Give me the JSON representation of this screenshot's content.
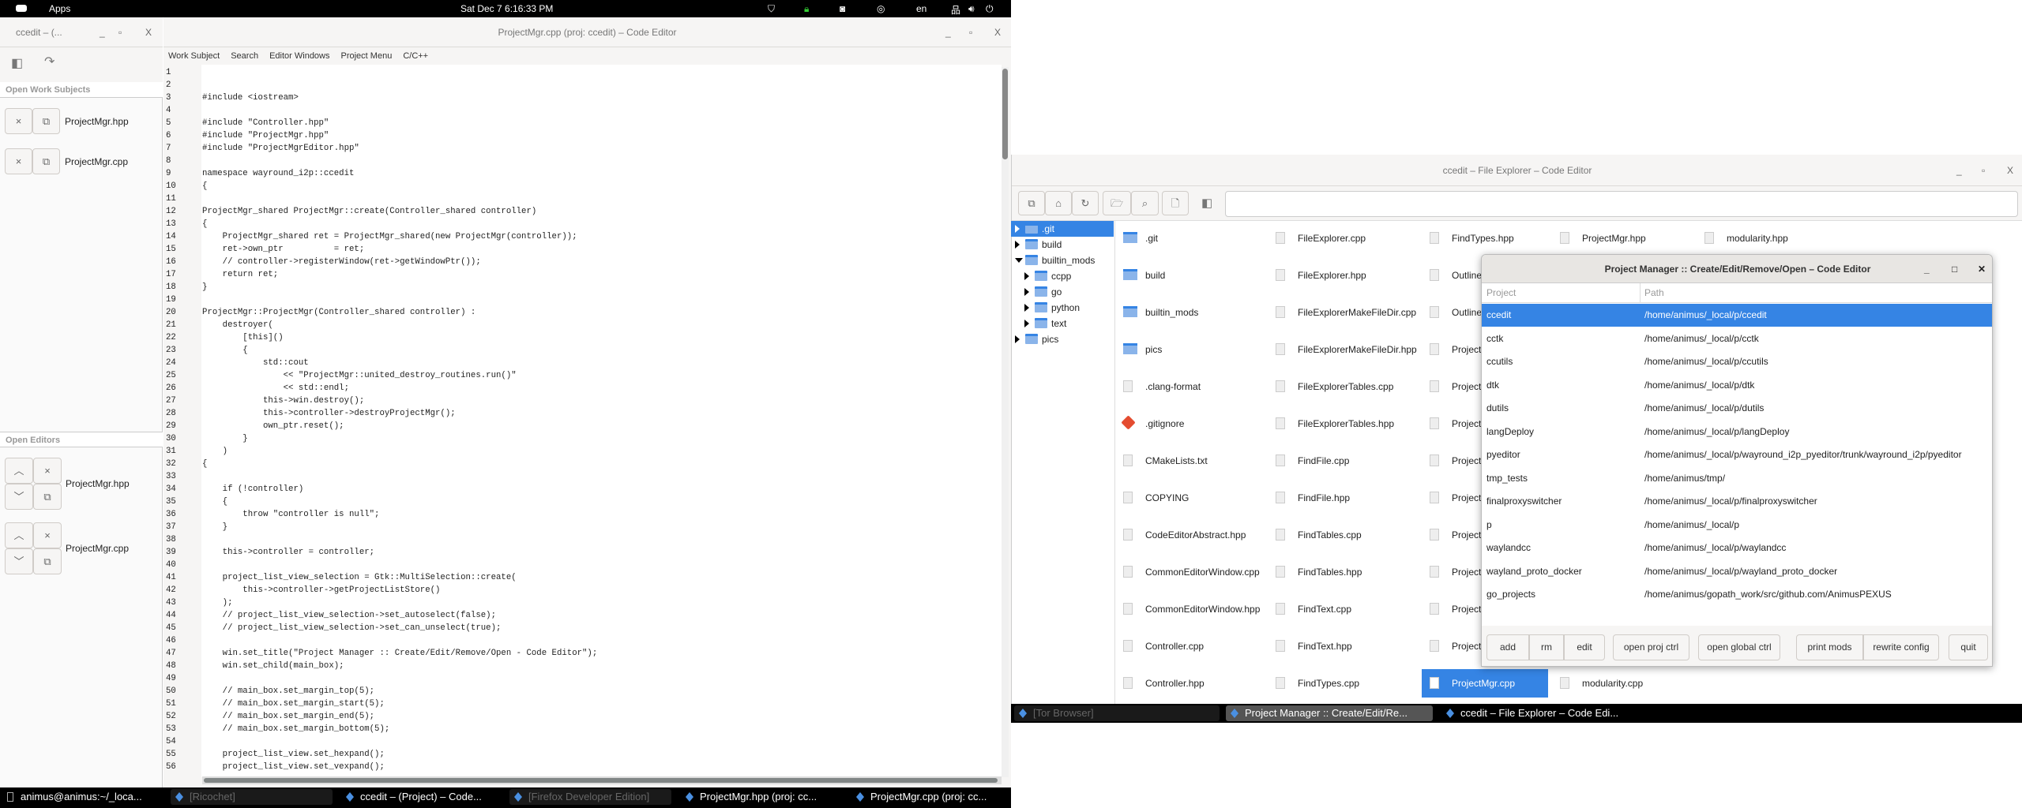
{
  "topbar": {
    "apps": "Apps",
    "datetime": "Sat Dec 7   6:16:33 PM",
    "lang": "en",
    "tray_icons": [
      "tor-icon",
      "lock-icon",
      "discord-icon",
      "steam-icon",
      "network-icon",
      "volume-icon",
      "power-icon"
    ]
  },
  "side_window": {
    "title": "ccedit – (...",
    "open_work_subjects": "Open Work Subjects",
    "work_subjects": [
      "ProjectMgr.hpp",
      "ProjectMgr.cpp"
    ],
    "open_editors": "Open Editors",
    "editors": [
      "ProjectMgr.hpp",
      "ProjectMgr.cpp"
    ]
  },
  "editor": {
    "title": "ProjectMgr.cpp (proj: ccedit) – Code Editor",
    "menu": [
      "Work Subject",
      "Search",
      "Editor Windows",
      "Project Menu",
      "C/C++"
    ],
    "lines": [
      "",
      "",
      "#include <iostream>",
      "",
      "#include \"Controller.hpp\"",
      "#include \"ProjectMgr.hpp\"",
      "#include \"ProjectMgrEditor.hpp\"",
      "",
      "namespace wayround_i2p::ccedit",
      "{",
      "",
      "ProjectMgr_shared ProjectMgr::create(Controller_shared controller)",
      "{",
      "    ProjectMgr_shared ret = ProjectMgr_shared(new ProjectMgr(controller));",
      "    ret->own_ptr          = ret;",
      "    // controller->registerWindow(ret->getWindowPtr());",
      "    return ret;",
      "}",
      "",
      "ProjectMgr::ProjectMgr(Controller_shared controller) :",
      "    destroyer(",
      "        [this]()",
      "        {",
      "            std::cout",
      "                << \"ProjectMgr::united_destroy_routines.run()\"",
      "                << std::endl;",
      "            this->win.destroy();",
      "            this->controller->destroyProjectMgr();",
      "            own_ptr.reset();",
      "        }",
      "    )",
      "{",
      "",
      "    if (!controller)",
      "    {",
      "        throw \"controller is null\";",
      "    }",
      "",
      "    this->controller = controller;",
      "",
      "    project_list_view_selection = Gtk::MultiSelection::create(",
      "        this->controller->getProjectListStore()",
      "    );",
      "    // project_list_view_selection->set_autoselect(false);",
      "    // project_list_view_selection->set_can_unselect(true);",
      "",
      "    win.set_title(\"Project Manager :: Create/Edit/Remove/Open - Code Editor\");",
      "    win.set_child(main_box);",
      "",
      "    // main_box.set_margin_top(5);",
      "    // main_box.set_margin_start(5);",
      "    // main_box.set_margin_end(5);",
      "    // main_box.set_margin_bottom(5);",
      "",
      "    project_list_view.set_hexpand();",
      "    project_list_view.set_vexpand();"
    ]
  },
  "taskbar_left": [
    {
      "label": "animus@animus:~/_loca...",
      "state": "normal",
      "icon": "terminal-icon"
    },
    {
      "label": "[Ricochet]",
      "state": "dim"
    },
    {
      "label": "ccedit – (Project) – Code...",
      "state": "normal"
    },
    {
      "label": "[Firefox Developer Edition]",
      "state": "dim"
    },
    {
      "label": "ProjectMgr.hpp (proj: cc...",
      "state": "normal"
    },
    {
      "label": "ProjectMgr.cpp (proj: cc...",
      "state": "normal"
    }
  ],
  "explorer": {
    "title": "ccedit – File Explorer – Code Editor",
    "path_value": "",
    "toolbar_icons": [
      "close-copy-icon",
      "home-icon",
      "refresh-icon",
      "open-folder-icon",
      "search-icon",
      "new-file-icon",
      "sidebar-icon"
    ],
    "tree": [
      {
        "label": ".git",
        "depth": 0,
        "expanded": false,
        "selected": true
      },
      {
        "label": "build",
        "depth": 0,
        "expanded": false
      },
      {
        "label": "builtin_mods",
        "depth": 0,
        "expanded": true
      },
      {
        "label": "ccpp",
        "depth": 1,
        "expanded": false
      },
      {
        "label": "go",
        "depth": 1,
        "expanded": false
      },
      {
        "label": "python",
        "depth": 1,
        "expanded": false
      },
      {
        "label": "text",
        "depth": 1,
        "expanded": false
      },
      {
        "label": "pics",
        "depth": 0,
        "expanded": false
      }
    ],
    "columns": [
      [
        {
          "n": ".git",
          "t": "dir"
        },
        {
          "n": "build",
          "t": "dir"
        },
        {
          "n": "builtin_mods",
          "t": "dir"
        },
        {
          "n": "pics",
          "t": "dir"
        },
        {
          "n": ".clang-format",
          "t": "file"
        },
        {
          "n": ".gitignore",
          "t": "git"
        },
        {
          "n": "CMakeLists.txt",
          "t": "file"
        },
        {
          "n": "COPYING",
          "t": "file"
        },
        {
          "n": "CodeEditorAbstract.hpp",
          "t": "file"
        },
        {
          "n": "CommonEditorWindow.cpp",
          "t": "file"
        },
        {
          "n": "CommonEditorWindow.hpp",
          "t": "file"
        },
        {
          "n": "Controller.cpp",
          "t": "file"
        },
        {
          "n": "Controller.hpp",
          "t": "file"
        }
      ],
      [
        {
          "n": "FileExplorer.cpp",
          "t": "file"
        },
        {
          "n": "FileExplorer.hpp",
          "t": "file"
        },
        {
          "n": "FileExplorerMakeFileDir.cpp",
          "t": "file"
        },
        {
          "n": "FileExplorerMakeFileDir.hpp",
          "t": "file"
        },
        {
          "n": "FileExplorerTables.cpp",
          "t": "file"
        },
        {
          "n": "FileExplorerTables.hpp",
          "t": "file"
        },
        {
          "n": "FindFile.cpp",
          "t": "file"
        },
        {
          "n": "FindFile.hpp",
          "t": "file"
        },
        {
          "n": "FindTables.cpp",
          "t": "file"
        },
        {
          "n": "FindTables.hpp",
          "t": "file"
        },
        {
          "n": "FindText.cpp",
          "t": "file"
        },
        {
          "n": "FindText.hpp",
          "t": "file"
        },
        {
          "n": "FindTypes.cpp",
          "t": "file"
        }
      ],
      [
        {
          "n": "FindTypes.hpp",
          "t": "file"
        },
        {
          "n": "Outline",
          "t": "file"
        },
        {
          "n": "Outline",
          "t": "file"
        },
        {
          "n": "Project",
          "t": "file"
        },
        {
          "n": "Project",
          "t": "file"
        },
        {
          "n": "Project",
          "t": "file"
        },
        {
          "n": "Project",
          "t": "file"
        },
        {
          "n": "Project",
          "t": "file"
        },
        {
          "n": "Project",
          "t": "file"
        },
        {
          "n": "Project",
          "t": "file"
        },
        {
          "n": "Project",
          "t": "file"
        },
        {
          "n": "Project",
          "t": "file"
        },
        {
          "n": "ProjectMgr.cpp",
          "t": "file",
          "selected": true
        }
      ],
      [
        {
          "n": "ProjectMgr.hpp",
          "t": "file"
        },
        null,
        null,
        null,
        null,
        null,
        null,
        null,
        null,
        null,
        null,
        null,
        {
          "n": "modularity.cpp",
          "t": "file"
        }
      ],
      [
        {
          "n": "modularity.hpp",
          "t": "file"
        }
      ]
    ]
  },
  "project_manager": {
    "title": "Project Manager :: Create/Edit/Remove/Open – Code Editor",
    "headers": [
      "Project",
      "Path"
    ],
    "rows": [
      [
        "ccedit",
        "/home/animus/_local/p/ccedit"
      ],
      [
        "cctk",
        "/home/animus/_local/p/cctk"
      ],
      [
        "ccutils",
        "/home/animus/_local/p/ccutils"
      ],
      [
        "dtk",
        "/home/animus/_local/p/dtk"
      ],
      [
        "dutils",
        "/home/animus/_local/p/dutils"
      ],
      [
        "langDeploy",
        "/home/animus/_local/p/langDeploy"
      ],
      [
        "pyeditor",
        "/home/animus/_local/p/wayround_i2p_pyeditor/trunk/wayround_i2p/pyeditor"
      ],
      [
        "tmp_tests",
        "/home/animus/tmp/"
      ],
      [
        "finalproxyswitcher",
        "/home/animus/_local/p/finalproxyswitcher"
      ],
      [
        "p",
        "/home/animus/_local/p"
      ],
      [
        "waylandcc",
        "/home/animus/_local/p/waylandcc"
      ],
      [
        "wayland_proto_docker",
        "/home/animus/_local/p/wayland_proto_docker"
      ],
      [
        "go_projects",
        "/home/animus/gopath_work/src/github.com/AnimusPEXUS"
      ]
    ],
    "selected_row": 0,
    "buttons": [
      "add",
      "rm",
      "edit",
      "open proj ctrl",
      "open global ctrl",
      "print mods",
      "rewrite config",
      "quit"
    ]
  },
  "taskbar_right": [
    {
      "label": "[Tor Browser]",
      "state": "dim"
    },
    {
      "label": "Project Manager :: Create/Edit/Re...",
      "state": "active"
    },
    {
      "label": "ccedit – File Explorer – Code Edi...",
      "state": "normal"
    }
  ],
  "colors": {
    "accent": "#3584e4",
    "taskbar": "#000000"
  }
}
